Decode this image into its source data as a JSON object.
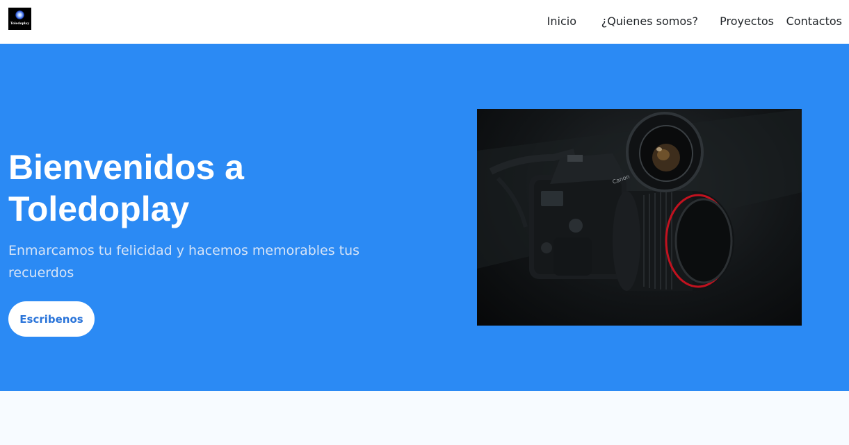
{
  "brand": {
    "logo_text": "Toledoplay",
    "logo_icon": "glowing-orb-logo"
  },
  "nav": {
    "items": [
      {
        "label": "Inicio"
      },
      {
        "label": "¿Quienes somos?"
      },
      {
        "label": "Proyectos"
      },
      {
        "label": "Contactos"
      }
    ]
  },
  "hero": {
    "title": "Bienvenidos a Toledoplay",
    "subtitle": "Enmarcamos tu felicidad y hacemos memorables tus recuerdos",
    "button_label": "Escribenos",
    "image": {
      "subject": "camera-with-lens-photo",
      "lens_label": "Canon"
    }
  },
  "colors": {
    "hero_background": "#2b8af4",
    "navbar_background": "#ffffff",
    "button_text": "#2a74d9",
    "page_background": "#f7fbff"
  }
}
